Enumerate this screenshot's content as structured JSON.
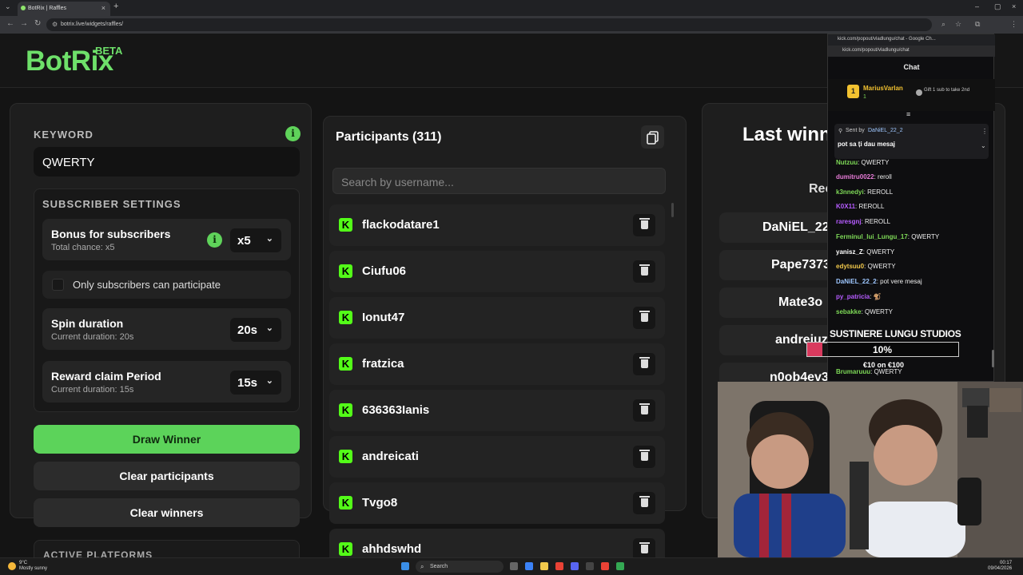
{
  "browser": {
    "tab_title": "BotRix | Raffles",
    "url": "botrix.live/widgets/raffles/"
  },
  "header": {
    "logo": "BotRix",
    "badge": "BETA"
  },
  "keyword": {
    "label": "KEYWORD",
    "value": "QWERTY"
  },
  "subscriber_settings": {
    "label": "SUBSCRIBER SETTINGS",
    "bonus": {
      "title": "Bonus for subscribers",
      "subtitle": "Total chance: x5",
      "value": "x5"
    },
    "only_subs": "Only subscribers can participate",
    "spin": {
      "title": "Spin duration",
      "subtitle": "Current duration: 20s",
      "value": "20s"
    },
    "reward": {
      "title": "Reward claim Period",
      "subtitle": "Current duration: 15s",
      "value": "15s"
    }
  },
  "buttons": {
    "draw": "Draw Winner",
    "clear_participants": "Clear participants",
    "clear_winners": "Clear winners"
  },
  "active_platforms": "ACTIVE PLATFORMS",
  "participants": {
    "title": "Participants (311)",
    "search_placeholder": "Search by username...",
    "list": [
      "flackodatare1",
      "Ciufu06",
      "Ionut47",
      "fratzica",
      "636363Ianis",
      "andreicati",
      "Tvgo8",
      "ahhdswhd"
    ]
  },
  "last_winners": {
    "title": "Last winne",
    "column": "Rec",
    "list": [
      "DaNiEL_22_",
      "Pape7373",
      "Mate3o",
      "andreiuz",
      "n0ob4ev3"
    ]
  },
  "chat": {
    "window_title": "kick.com/popout/vladlungu/chat - Google Ch...",
    "url": "kick.com/popout/vladlungu/chat",
    "header": "Chat",
    "gifter": {
      "name": "MariusVarlan",
      "count": "1",
      "note": "Gift 1 sub to take 2nd"
    },
    "pinned": {
      "sent_by_label": "Sent by",
      "sender": "DaNiEL_22_2",
      "text": "pot sa ți dau mesaj"
    },
    "messages": [
      {
        "user": "Nutzuu",
        "color": "#7ed957",
        "text": ": QWERTY"
      },
      {
        "user": "dumitru0022",
        "color": "#e87bd8",
        "text": ": reroll"
      },
      {
        "user": "k3nnedyi",
        "color": "#7ed957",
        "text": ": REROLL"
      },
      {
        "user": "K0X11",
        "color": "#b65cff",
        "text": ": REROLL"
      },
      {
        "user": "raresgnj",
        "color": "#b65cff",
        "text": ": REROLL"
      },
      {
        "user": "Ferminul_lui_Lungu_17",
        "color": "#7ed957",
        "text": ": QWERTY"
      },
      {
        "user": "yanisz_Z",
        "color": "#ffffff",
        "text": ": QWERTY"
      },
      {
        "user": "edytsuu0",
        "color": "#f2c94c",
        "text": ": QWERTY"
      },
      {
        "user": "DaNiEL_22_2",
        "color": "#9ec7ff",
        "text": ": pot vere mesaj"
      },
      {
        "user": "py_patricia",
        "color": "#b65cff",
        "text": ": 🐒"
      },
      {
        "user": "sebakke",
        "color": "#7ed957",
        "text": ": QWERTY"
      },
      {
        "user": "Brumaruuu",
        "color": "#7ed957",
        "text": ": QWERTY"
      }
    ]
  },
  "overlay": {
    "title": "SUSTINERE LUNGU STUDIOS",
    "percent": "10%",
    "progress": 0.1,
    "amount": "€10 on €100"
  },
  "taskbar": {
    "weather_temp": "9°C",
    "weather_desc": "Mostly sunny",
    "search": "Search",
    "time": "00:17",
    "date": "09/04/2026"
  },
  "colors": {
    "accent": "#5cd35a",
    "kick_green": "#53fc18",
    "panel": "#1e1e1e"
  }
}
